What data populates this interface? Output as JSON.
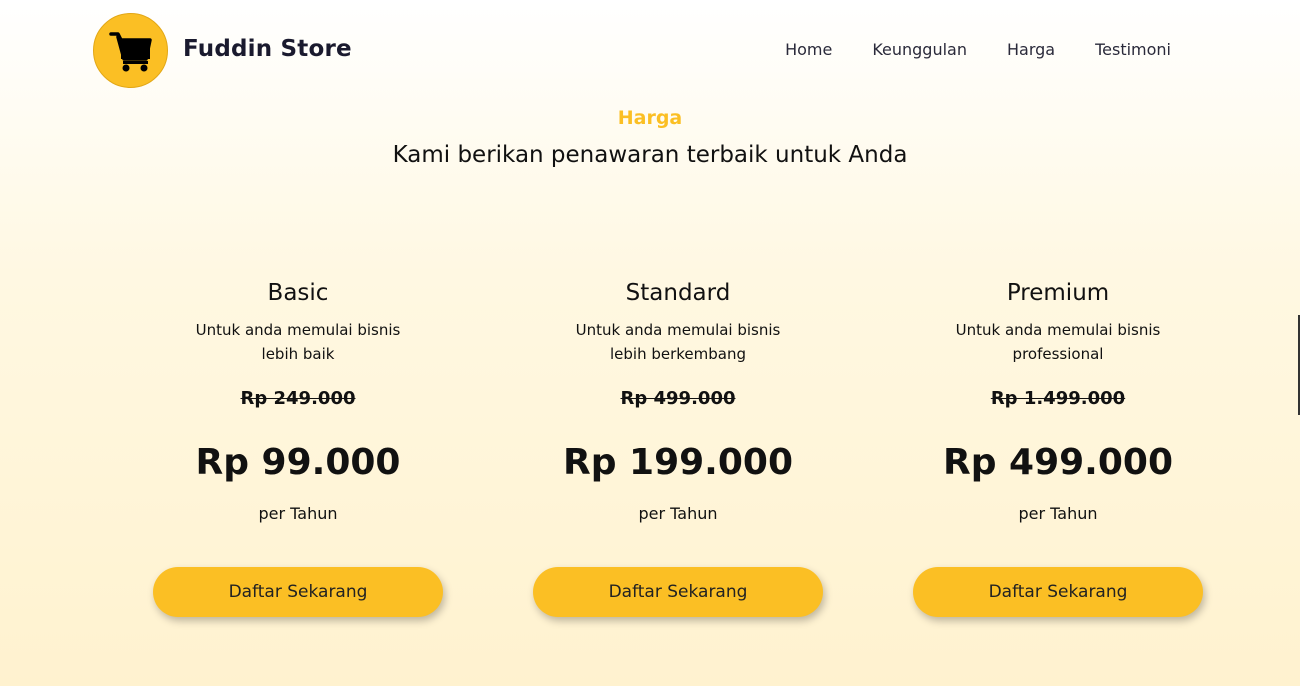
{
  "brand": {
    "name": "Fuddin Store",
    "logo_icon": "shopping-cart-icon",
    "accent": "#fbbf24"
  },
  "nav": [
    {
      "label": "Home"
    },
    {
      "label": "Keunggulan"
    },
    {
      "label": "Harga"
    },
    {
      "label": "Testimoni"
    }
  ],
  "section": {
    "tag": "Harga",
    "subtitle": "Kami berikan penawaran terbaik untuk Anda"
  },
  "plans": [
    {
      "name": "Basic",
      "desc": "Untuk anda memulai bisnis lebih baik",
      "old_price": "Rp 249.000",
      "price": "Rp 99.000",
      "period": "per Tahun",
      "cta": "Daftar Sekarang"
    },
    {
      "name": "Standard",
      "desc": "Untuk anda memulai bisnis lebih berkembang",
      "old_price": "Rp 499.000",
      "price": "Rp 199.000",
      "period": "per Tahun",
      "cta": "Daftar Sekarang"
    },
    {
      "name": "Premium",
      "desc": "Untuk anda memulai bisnis professional",
      "old_price": "Rp 1.499.000",
      "price": "Rp 499.000",
      "period": "per Tahun",
      "cta": "Daftar Sekarang"
    }
  ]
}
